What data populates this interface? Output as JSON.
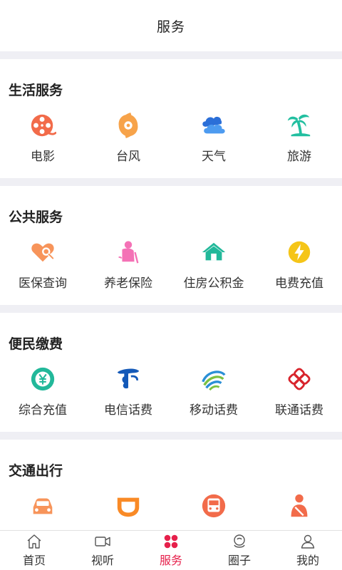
{
  "header": {
    "title": "服务"
  },
  "sections": [
    {
      "title": "生活服务",
      "items": [
        {
          "label": "电影",
          "icon": "film-icon",
          "color": "#f26b4a"
        },
        {
          "label": "台风",
          "icon": "typhoon-icon",
          "color": "#f7a34a"
        },
        {
          "label": "天气",
          "icon": "weather-icon",
          "color": "#3b7ee8"
        },
        {
          "label": "旅游",
          "icon": "palm-tree-icon",
          "color": "#22bfa0"
        }
      ]
    },
    {
      "title": "公共服务",
      "items": [
        {
          "label": "医保查询",
          "icon": "medical-insurance-icon",
          "color": "#f7945a"
        },
        {
          "label": "养老保险",
          "icon": "elderly-icon",
          "color": "#f472b6"
        },
        {
          "label": "住房公积金",
          "icon": "house-icon",
          "color": "#22b89a"
        },
        {
          "label": "电费充值",
          "icon": "electricity-icon",
          "color": "#f5c518"
        }
      ]
    },
    {
      "title": "便民缴费",
      "items": [
        {
          "label": "综合充值",
          "icon": "yuan-recharge-icon",
          "color": "#22b89a"
        },
        {
          "label": "电信话费",
          "icon": "china-telecom-icon",
          "color": "#1459b8"
        },
        {
          "label": "移动话费",
          "icon": "china-mobile-icon",
          "color": "#2a8fd6"
        },
        {
          "label": "联通话费",
          "icon": "china-unicom-icon",
          "color": "#d8242c"
        }
      ]
    },
    {
      "title": "交通出行",
      "items": [
        {
          "label": "",
          "icon": "car-icon",
          "color": "#f7945a"
        },
        {
          "label": "",
          "icon": "didi-icon",
          "color": "#f98a26"
        },
        {
          "label": "",
          "icon": "bus-icon",
          "color": "#f26b4a"
        },
        {
          "label": "",
          "icon": "driver-icon",
          "color": "#f26b4a"
        }
      ]
    }
  ],
  "tabbar": {
    "active_color": "#e6204b",
    "items": [
      {
        "label": "首页",
        "icon": "home-icon"
      },
      {
        "label": "视听",
        "icon": "video-camera-icon"
      },
      {
        "label": "服务",
        "icon": "service-grid-icon",
        "active": true
      },
      {
        "label": "圈子",
        "icon": "circle-community-icon"
      },
      {
        "label": "我的",
        "icon": "user-icon"
      }
    ]
  }
}
